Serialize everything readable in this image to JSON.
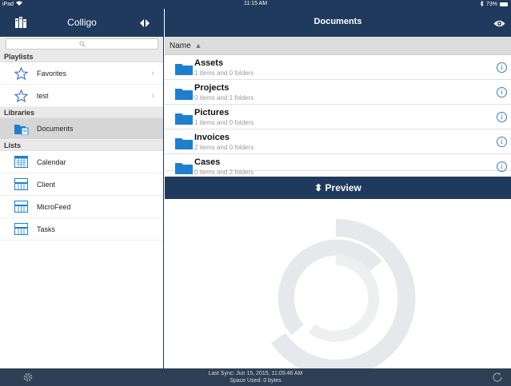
{
  "status_bar": {
    "device": "iPad",
    "time": "11:15 AM",
    "battery": "73%"
  },
  "left_pane": {
    "title": "Colligo",
    "search_placeholder": "",
    "sections": {
      "playlists": "Playlists",
      "libraries": "Libraries",
      "lists": "Lists"
    },
    "playlists": [
      {
        "label": "Favorites"
      },
      {
        "label": "test"
      }
    ],
    "libraries": [
      {
        "label": "Documents",
        "selected": true
      }
    ],
    "lists": [
      {
        "label": "Calendar"
      },
      {
        "label": "Client"
      },
      {
        "label": "MicroFeed"
      },
      {
        "label": "Tasks"
      }
    ]
  },
  "right_pane": {
    "title": "Documents",
    "sort_label": "Name",
    "items": [
      {
        "name": "Assets",
        "detail": "1 items and 0 folders"
      },
      {
        "name": "Projects",
        "detail": "0 items and 1 folders"
      },
      {
        "name": "Pictures",
        "detail": "1 items and 0 folders"
      },
      {
        "name": "Invoices",
        "detail": "2 items and 0 folders"
      },
      {
        "name": "Cases",
        "detail": "0 items and 2 folders"
      }
    ],
    "preview_label": "Preview"
  },
  "bottom_bar": {
    "last_sync": "Last Sync: Jun 15, 2015, 11:05:46 AM",
    "space_used": "Space Used: 0 bytes"
  },
  "colors": {
    "navy": "#1f3a5c",
    "bottom": "#2f3f55",
    "folder": "#1e7fd0",
    "accent": "#3b78c4"
  }
}
